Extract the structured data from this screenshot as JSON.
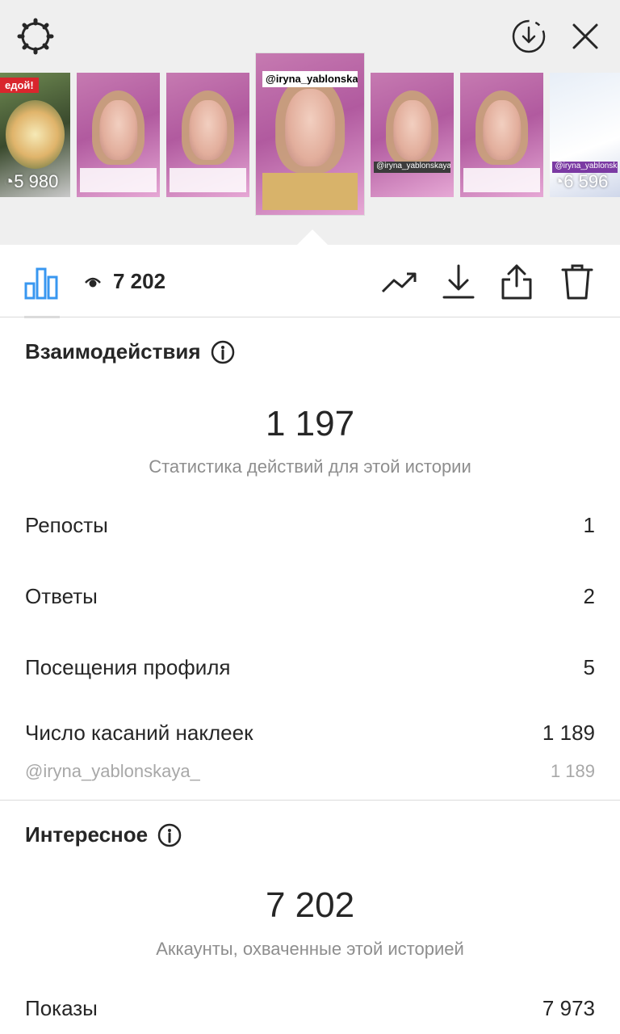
{
  "top": {
    "icons": [
      "gear-icon",
      "download-circle-icon",
      "close-icon"
    ]
  },
  "thumbnails": [
    {
      "kind": "food",
      "tag": "едой!",
      "views": "5 980"
    },
    {
      "kind": "person",
      "views": ""
    },
    {
      "kind": "person",
      "views": ""
    },
    {
      "kind": "person-active",
      "username": "@iryna_yablonskaya_"
    },
    {
      "kind": "person",
      "username": "@iryna_yablonskaya",
      "views": ""
    },
    {
      "kind": "person",
      "views": ""
    },
    {
      "kind": "doctors",
      "username": "@iryna_yablonskaya",
      "views": "6 596"
    }
  ],
  "toolbar": {
    "views": "7 202",
    "icons": [
      "bar-chart-icon",
      "eye-icon",
      "trend-icon",
      "download-icon",
      "share-icon",
      "trash-icon"
    ]
  },
  "interactions": {
    "title": "Взаимодействия",
    "total": "1 197",
    "subtitle": "Статистика действий для этой истории",
    "rows": [
      {
        "label": "Репосты",
        "value": "1"
      },
      {
        "label": "Ответы",
        "value": "2"
      },
      {
        "label": "Посещения профиля",
        "value": "5"
      },
      {
        "label": "Число касаний наклеек",
        "value": "1 189"
      }
    ],
    "sticker": {
      "label": "@iryna_yablonskaya_",
      "value": "1 189"
    }
  },
  "discovery": {
    "title": "Интересное",
    "total": "7 202",
    "subtitle": "Аккаунты, охваченные этой историей",
    "rows": [
      {
        "label": "Показы",
        "value": "7 973"
      }
    ]
  },
  "colors": {
    "accent": "#3897f0",
    "text": "#262626",
    "muted": "#8e8e8e",
    "topbar": "#efefef"
  }
}
